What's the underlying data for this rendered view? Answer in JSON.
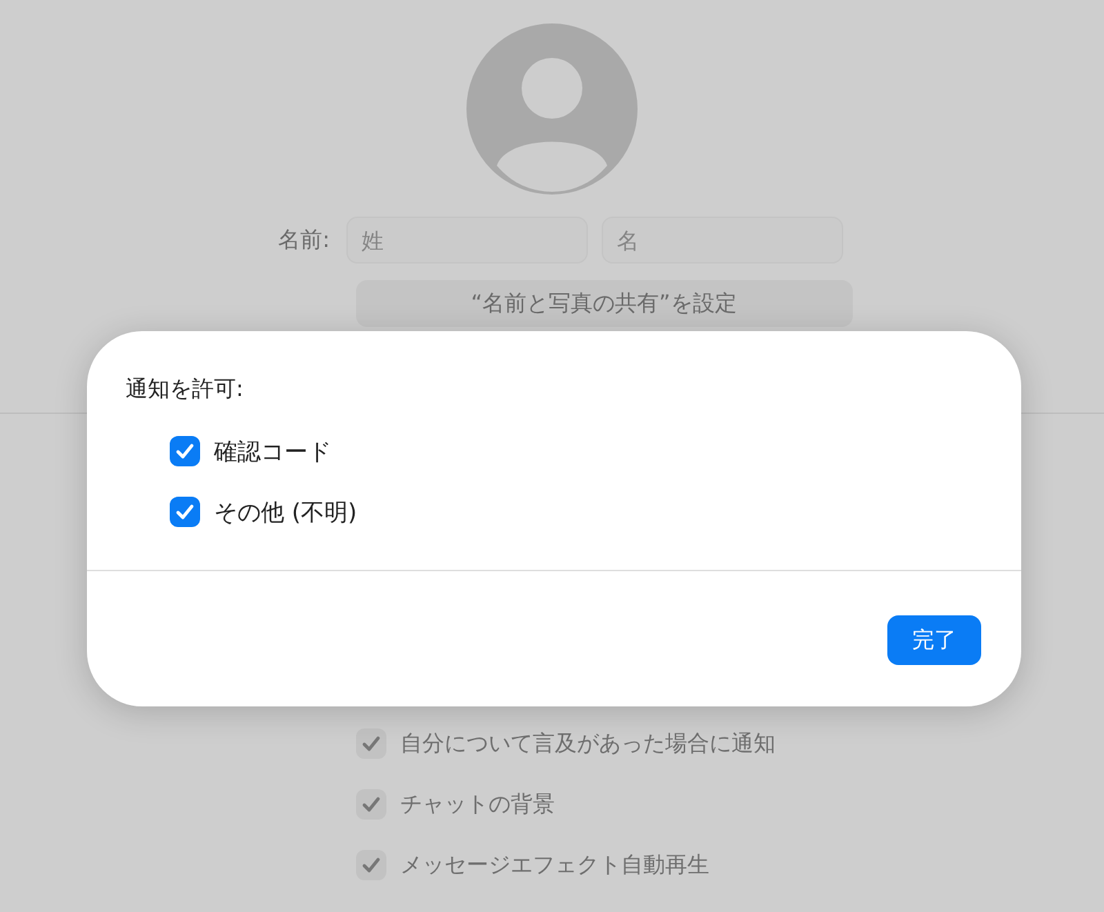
{
  "profile": {
    "name_label": "名前:",
    "fields": [
      {
        "placeholder": "姓"
      },
      {
        "placeholder": "名"
      }
    ],
    "share_button": "“名前と写真の共有”を設定"
  },
  "settings": [
    {
      "label": "自分について言及があった場合に通知",
      "checked": true
    },
    {
      "label": "チャットの背景",
      "checked": true
    },
    {
      "label": "メッセージエフェクト自動再生",
      "checked": true
    }
  ],
  "dialog": {
    "title": "通知を許可:",
    "options": [
      {
        "label": "確認コード",
        "checked": true
      },
      {
        "label": "その他 (不明)",
        "checked": true
      }
    ],
    "done_button": "完了"
  }
}
